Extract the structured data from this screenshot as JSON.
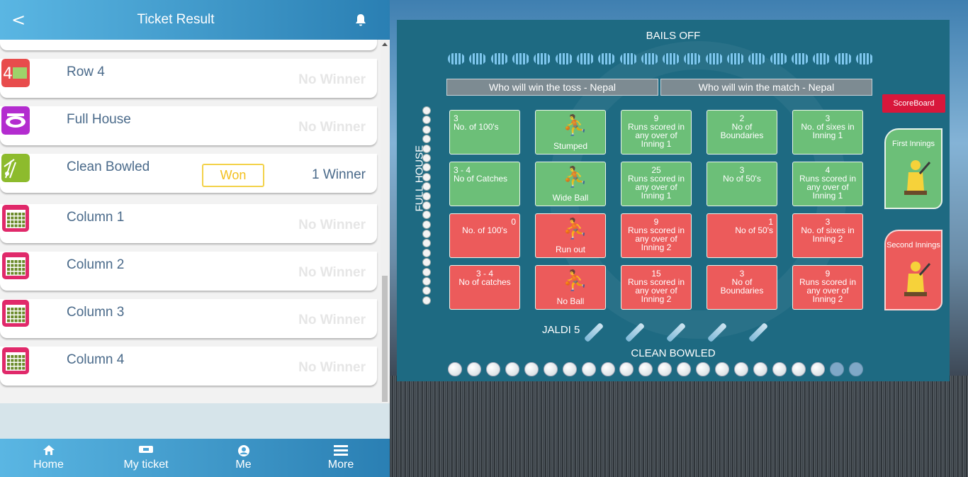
{
  "header": {
    "back_glyph": "<",
    "title": "Ticket Result",
    "bell_icon": "bell-icon"
  },
  "cards": [
    {
      "name": "Row 4",
      "result": "No Winner",
      "icon": "row-4-icon",
      "icon_color": "#e84c4c"
    },
    {
      "name": "Full House",
      "result": "No Winner",
      "icon": "stadium-icon",
      "icon_color": "#b32ccf"
    },
    {
      "name": "Clean Bowled",
      "won_label": "Won",
      "result": "1 Winner",
      "icon": "stumps-icon",
      "icon_color": "#8dbb2d"
    },
    {
      "name": "Column 1",
      "result": "No Winner",
      "icon": "column-grid-icon",
      "icon_color": "#e0296a"
    },
    {
      "name": "Column 2",
      "result": "No Winner",
      "icon": "column-grid-icon",
      "icon_color": "#e0296a"
    },
    {
      "name": "Column 3",
      "result": "No Winner",
      "icon": "column-grid-icon",
      "icon_color": "#e0296a"
    },
    {
      "name": "Column 4",
      "result": "No Winner",
      "icon": "column-grid-icon",
      "icon_color": "#e0296a"
    }
  ],
  "bottom_nav": [
    {
      "label": "Home",
      "icon": "home-icon"
    },
    {
      "label": "My ticket",
      "icon": "ticket-icon"
    },
    {
      "label": "Me",
      "icon": "profile-icon"
    },
    {
      "label": "More",
      "icon": "menu-icon"
    }
  ],
  "game": {
    "bails_off": "BAILS OFF",
    "toss_question": "Who will win the toss - Nepal",
    "match_question": "Who will win the match - Nepal",
    "full_house": "FULL HOUSE",
    "jaldi": "JALDI 5",
    "clean_bowled": "CLEAN BOWLED",
    "scoreboard": "ScoreBoard",
    "first_innings": "First Innings",
    "second_innings": "Second Innings",
    "clean_bowled_balls_total": 22,
    "clean_bowled_balls_done": 20,
    "tiles": [
      {
        "l1": "3",
        "l2": "No. of 100's",
        "color": "green"
      },
      {
        "l1": "",
        "l2": "Stumped",
        "color": "green"
      },
      {
        "l1": "9",
        "l2": "Runs scored in any over of Inning 1",
        "color": "green"
      },
      {
        "l1": "2",
        "l2": "No of Boundaries",
        "color": "green"
      },
      {
        "l1": "3",
        "l2": "No. of sixes in Inning 1",
        "color": "green"
      },
      {
        "l1": "3 - 4",
        "l2": "No of Catches",
        "color": "green"
      },
      {
        "l1": "",
        "l2": "Wide Ball",
        "color": "green"
      },
      {
        "l1": "25",
        "l2": "Runs scored in any over of Inning 1",
        "color": "green"
      },
      {
        "l1": "3",
        "l2": "No of 50's",
        "color": "green"
      },
      {
        "l1": "4",
        "l2": "Runs scored in any over of Inning 1",
        "color": "green"
      },
      {
        "l1": "0",
        "l2": "No. of 100's",
        "color": "red"
      },
      {
        "l1": "",
        "l2": "Run out",
        "color": "red"
      },
      {
        "l1": "9",
        "l2": "Runs scored in any over of Inning 2",
        "color": "red"
      },
      {
        "l1": "1",
        "l2": "No of 50's",
        "color": "red"
      },
      {
        "l1": "3",
        "l2": "No. of sixes in Inning 2",
        "color": "red"
      },
      {
        "l1": "3 - 4",
        "l2": "No of catches",
        "color": "red"
      },
      {
        "l1": "",
        "l2": "No Ball",
        "color": "red"
      },
      {
        "l1": "15",
        "l2": "Runs scored in any over of Inning 2",
        "color": "red"
      },
      {
        "l1": "3",
        "l2": "No of Boundaries",
        "color": "red"
      },
      {
        "l1": "9",
        "l2": "Runs scored in any over of Inning 2",
        "color": "red"
      }
    ]
  }
}
